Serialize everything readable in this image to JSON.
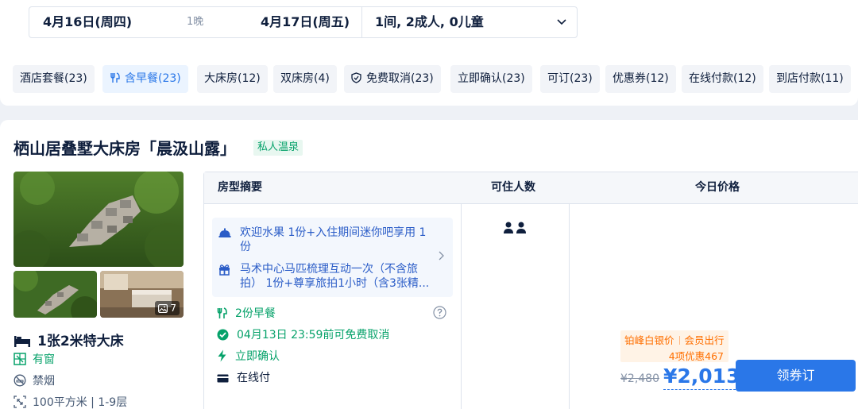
{
  "search": {
    "checkin": "4月16日(周四)",
    "nights": "1晚",
    "checkout": "4月17日(周五)",
    "guests": "1间, 2成人, 0儿童"
  },
  "filters": [
    {
      "label": "酒店套餐(23)",
      "active": false
    },
    {
      "label": "含早餐(23)",
      "active": true,
      "icon": "utensils-icon"
    },
    {
      "label": "大床房(12)",
      "active": false
    },
    {
      "label": "双床房(4)",
      "active": false
    },
    {
      "label": "免费取消(23)",
      "active": false,
      "icon": "shield-check-icon"
    },
    {
      "label": "立即确认(23)",
      "active": false
    },
    {
      "label": "可订(23)",
      "active": false
    },
    {
      "label": "优惠券(12)",
      "active": false
    },
    {
      "label": "在线付款(12)",
      "active": false
    },
    {
      "label": "到店付款(11)",
      "active": false
    }
  ],
  "room": {
    "title": "栖山居叠墅大床房「晨汲山露」",
    "tag": "私人温泉",
    "photo_count": "7",
    "bed": "1张2米特大床",
    "window": "有窗",
    "smoking": "禁烟",
    "area": "100平方米 | 1-9层"
  },
  "table": {
    "headers": {
      "summary": "房型摘要",
      "occupancy": "可住人数",
      "price": "今日价格"
    },
    "benefits": [
      {
        "icon": "service-bell-icon",
        "text": "欢迎水果 1份+入住期间迷你吧享用 1份"
      },
      {
        "icon": "gift-icon",
        "text": "马术中心马匹梳理互动一次（不含旅拍） 1份+尊享旅拍1小时（含3张精..."
      }
    ],
    "policies": {
      "breakfast": "2份早餐",
      "cancel": "04月13日 23:59前可免费取消",
      "confirm": "立即确认",
      "payment": "在线付"
    },
    "occupancy_count": 2,
    "promo": {
      "tier": "铂峰白银价",
      "member": "会员出行",
      "discount": "4项优惠467"
    },
    "original_price": "¥2,480",
    "price": "¥2,013",
    "book_label": "领券订"
  },
  "colors": {
    "accent": "#2a77e8",
    "green": "#06a26a",
    "orange": "#ff6f00",
    "text": "#0f1f3d"
  }
}
